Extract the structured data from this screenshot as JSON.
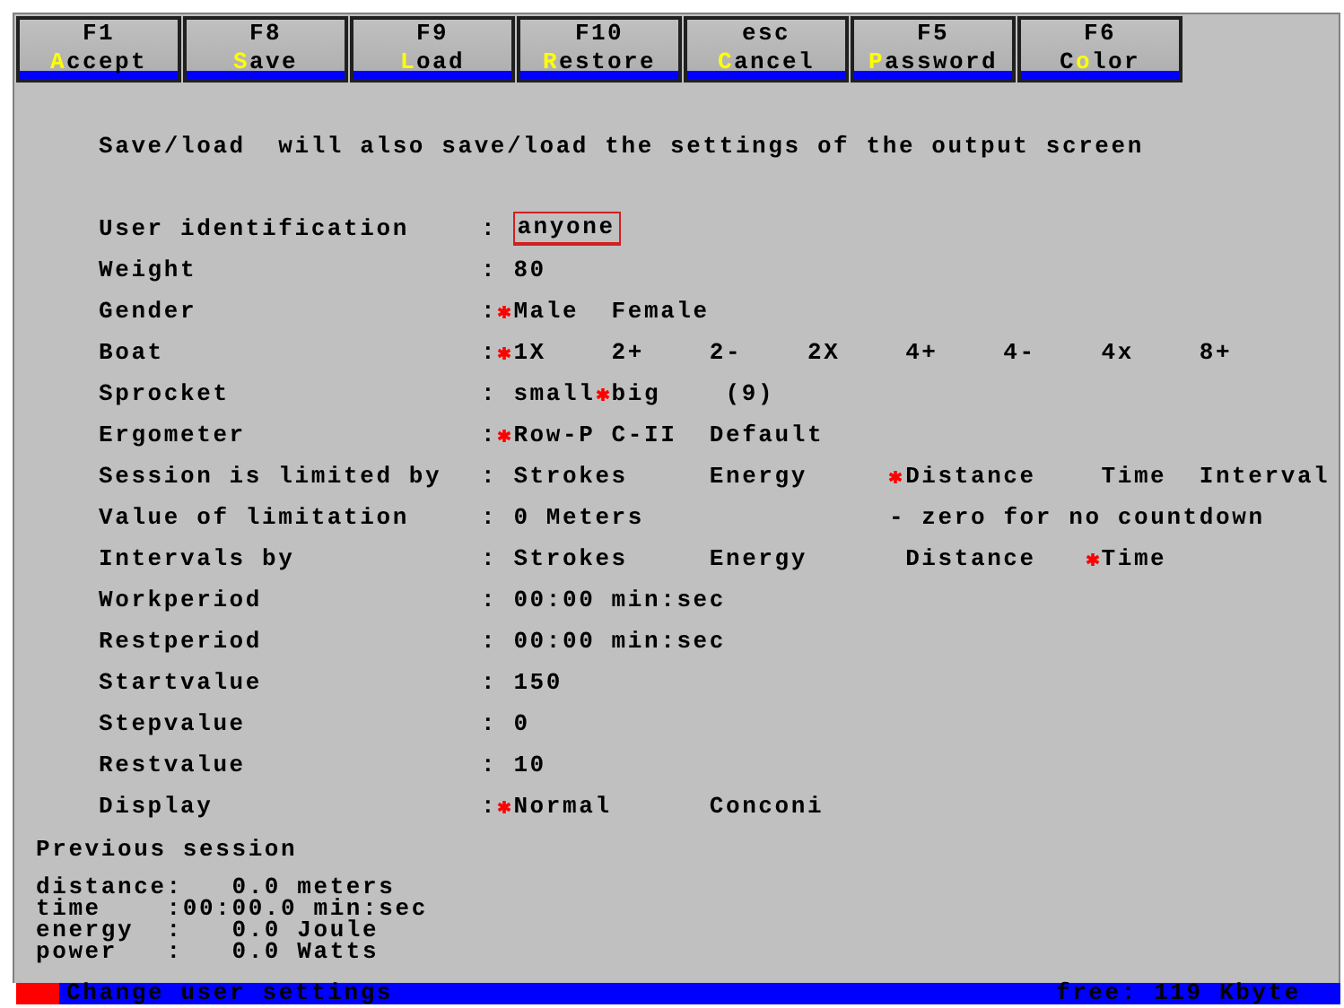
{
  "function_keys": [
    {
      "key": "F1",
      "label": "**A**ccept"
    },
    {
      "key": "F8",
      "label": "**S**ave"
    },
    {
      "key": "F9",
      "label": "**L**oad"
    },
    {
      "key": "F10",
      "label": "**R**estore"
    },
    {
      "key": "esc",
      "label": "**C**ancel"
    },
    {
      "key": "F5",
      "label": "**P**assword"
    },
    {
      "key": "F6",
      "label": "C**o**lor"
    }
  ],
  "intro": "Save/load  will also save/load the settings of the output screen",
  "settings": [
    {
      "label": "User identification",
      "separator": ":",
      "kind": "field",
      "value": "anyone"
    },
    {
      "label": "Weight",
      "separator": ":",
      "kind": "value",
      "value": "80"
    },
    {
      "label": "Gender",
      "separator": ":",
      "kind": "choice",
      "options": [
        {
          "label": "Male",
          "selected": true
        },
        {
          "label": "Female",
          "selected": false
        }
      ]
    },
    {
      "label": "Boat",
      "separator": ":",
      "kind": "choice",
      "options": [
        {
          "label": "1X",
          "selected": true
        },
        {
          "label": "2+",
          "selected": false
        },
        {
          "label": "2-",
          "selected": false
        },
        {
          "label": "2X",
          "selected": false
        },
        {
          "label": "4+",
          "selected": false
        },
        {
          "label": "4-",
          "selected": false
        },
        {
          "label": "4x",
          "selected": false
        },
        {
          "label": "8+",
          "selected": false
        }
      ]
    },
    {
      "label": "Sprocket",
      "separator": ":",
      "kind": "choice",
      "options": [
        {
          "label": "small",
          "selected": false
        },
        {
          "label": "big",
          "selected": true
        }
      ],
      "note": "(9)"
    },
    {
      "label": "Ergometer",
      "separator": ":",
      "kind": "choice",
      "options": [
        {
          "label": "Row-P",
          "selected": true
        },
        {
          "label": "C-II",
          "selected": false
        },
        {
          "label": "Default",
          "selected": false
        }
      ]
    },
    {
      "label": "Session is limited by",
      "separator": ":",
      "kind": "choice",
      "options": [
        {
          "label": "Strokes",
          "selected": false
        },
        {
          "label": "Energy",
          "selected": false
        },
        {
          "label": "Distance",
          "selected": true
        },
        {
          "label": "Time",
          "selected": false
        },
        {
          "label": "Interval",
          "selected": false
        }
      ]
    },
    {
      "label": "Value of limitation",
      "separator": ":",
      "kind": "value",
      "value": "0 Meters",
      "note": "- zero for no countdown"
    },
    {
      "label": "Intervals by",
      "separator": ":",
      "kind": "choice",
      "options": [
        {
          "label": "Strokes",
          "selected": false
        },
        {
          "label": "Energy",
          "selected": false
        },
        {
          "label": "Distance",
          "selected": false
        },
        {
          "label": "Time",
          "selected": true
        }
      ]
    },
    {
      "label": "Workperiod",
      "separator": ":",
      "kind": "value",
      "value": "00:00 min:sec"
    },
    {
      "label": "Restperiod",
      "separator": ":",
      "kind": "value",
      "value": "00:00 min:sec"
    },
    {
      "label": "Startvalue",
      "separator": ":",
      "kind": "value",
      "value": "150"
    },
    {
      "label": "Stepvalue",
      "separator": ":",
      "kind": "value",
      "value": "0"
    },
    {
      "label": "Restvalue",
      "separator": ":",
      "kind": "value",
      "value": "10"
    },
    {
      "label": "Display",
      "separator": ":",
      "kind": "choice",
      "options": [
        {
          "label": "Normal",
          "selected": true
        },
        {
          "label": "Conconi",
          "selected": false
        }
      ]
    }
  ],
  "previous_session": {
    "title": "Previous session",
    "lines": [
      "distance:   0.0 meters",
      "time    :00:00.0 min:sec",
      "energy  :   0.0 Joule",
      "power   :   0.0 Watts"
    ]
  },
  "status_bar": {
    "message": "Change user settings",
    "memory": "free: 119 Kbyte"
  }
}
